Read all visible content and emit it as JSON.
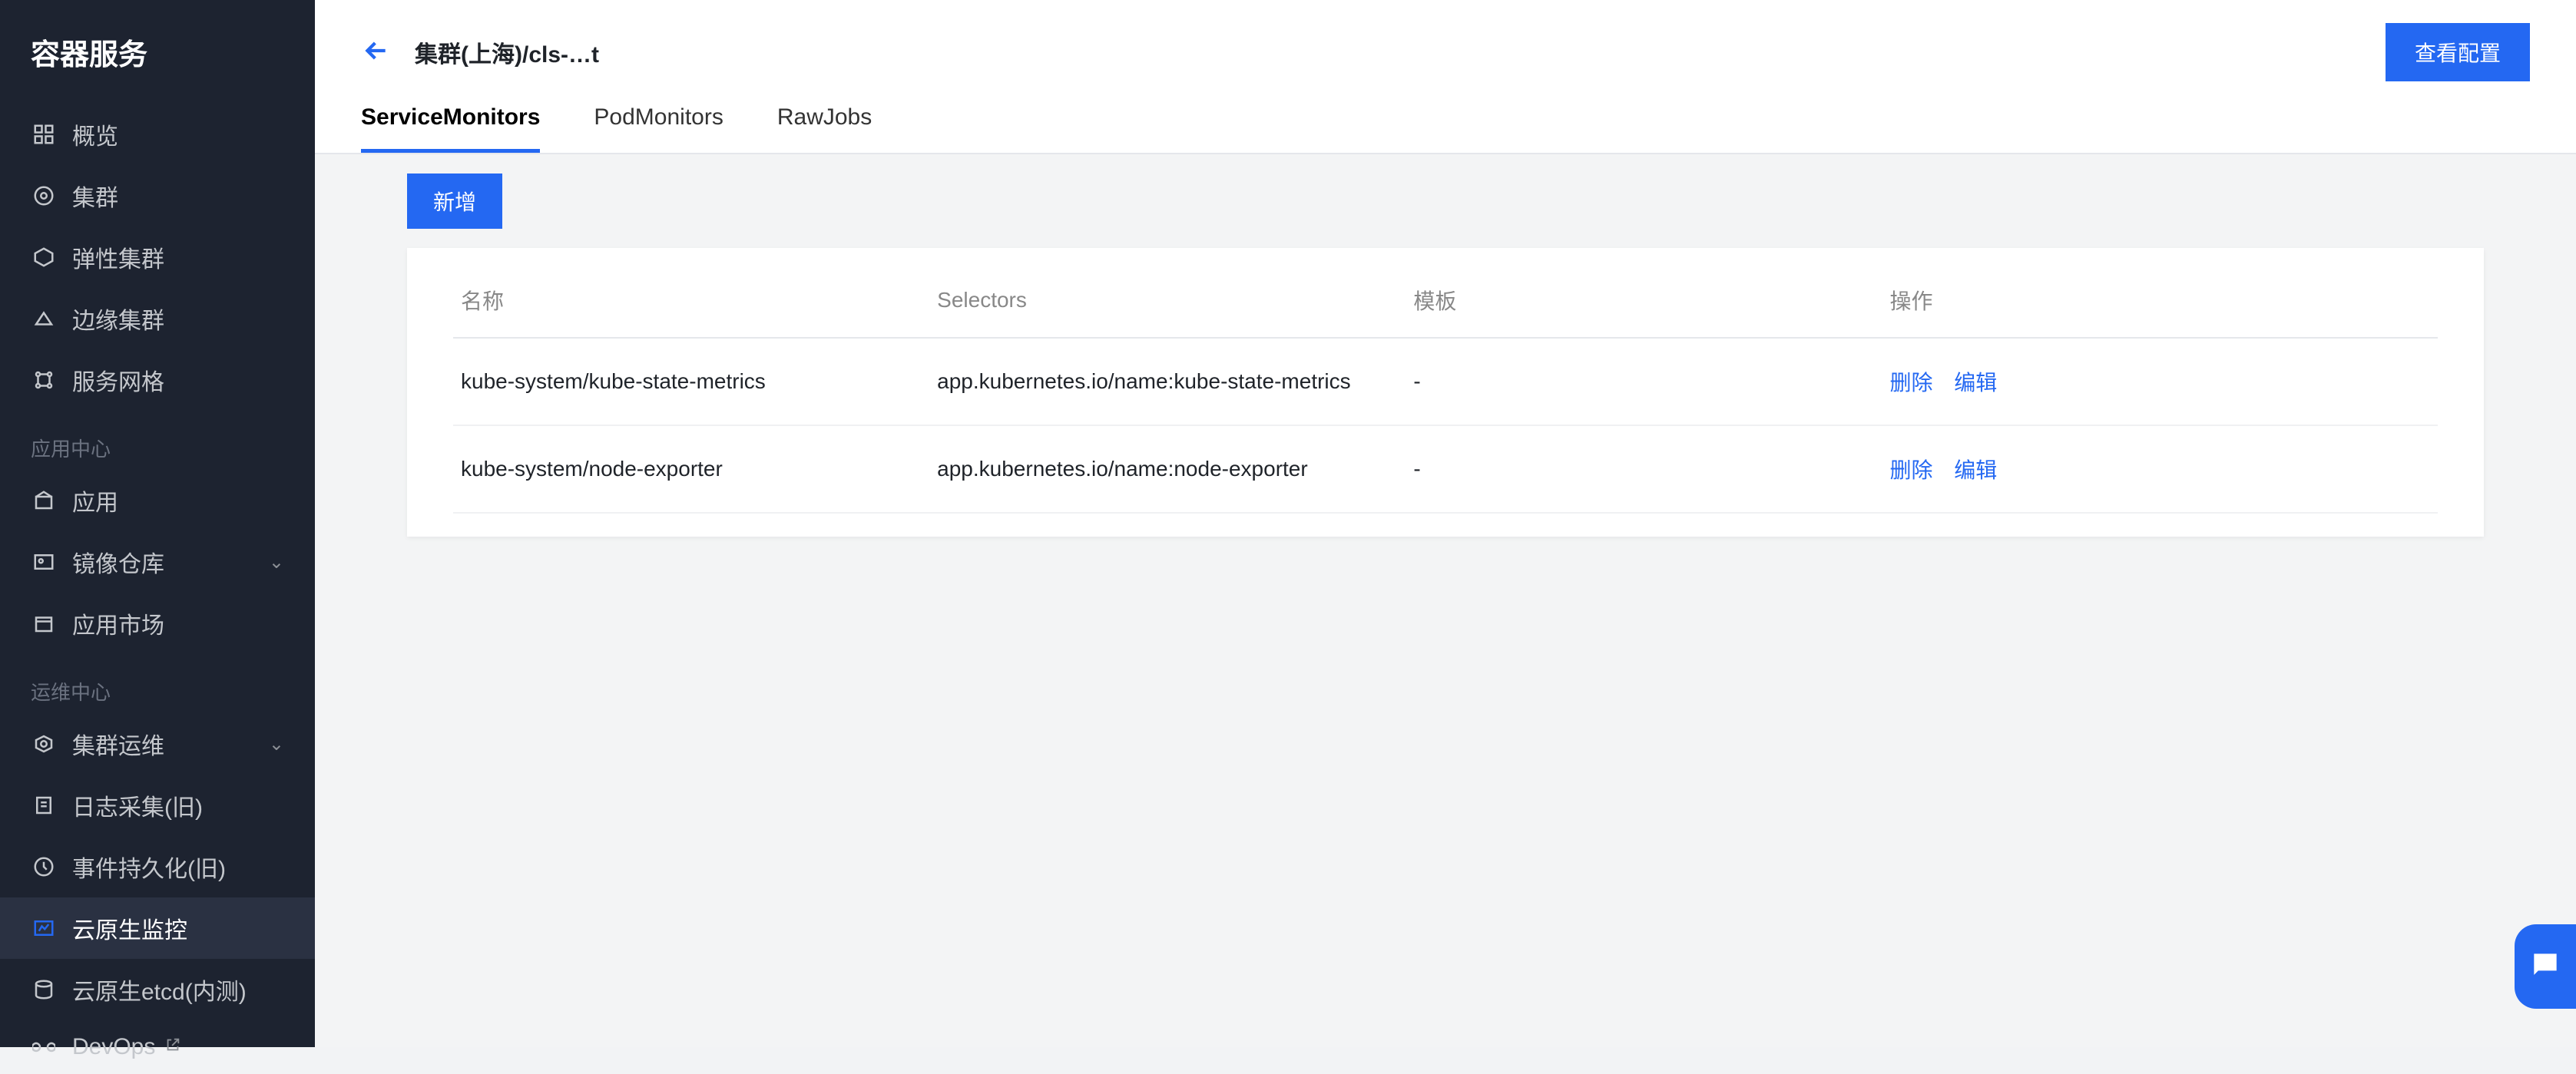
{
  "sidebar": {
    "title": "容器服务",
    "sections": [
      {
        "items": [
          {
            "label": "概览",
            "icon": "grid-icon"
          },
          {
            "label": "集群",
            "icon": "target-icon"
          },
          {
            "label": "弹性集群",
            "icon": "cluster-icon"
          },
          {
            "label": "边缘集群",
            "icon": "edge-icon"
          },
          {
            "label": "服务网格",
            "icon": "mesh-icon"
          }
        ]
      },
      {
        "label": "应用中心",
        "items": [
          {
            "label": "应用",
            "icon": "app-icon"
          },
          {
            "label": "镜像仓库",
            "icon": "image-repo-icon",
            "chevron": true
          },
          {
            "label": "应用市场",
            "icon": "market-icon"
          }
        ]
      },
      {
        "label": "运维中心",
        "items": [
          {
            "label": "集群运维",
            "icon": "ops-icon",
            "chevron": true
          },
          {
            "label": "日志采集(旧)",
            "icon": "log-icon"
          },
          {
            "label": "事件持久化(旧)",
            "icon": "event-icon"
          },
          {
            "label": "云原生监控",
            "icon": "monitor-icon",
            "active": true
          },
          {
            "label": "云原生etcd(内测)",
            "icon": "etcd-icon"
          },
          {
            "label": "DevOps",
            "icon": "devops-icon",
            "external": true
          }
        ]
      }
    ]
  },
  "header": {
    "breadcrumb": "集群(上海)/cls-…t",
    "view_config_label": "查看配置"
  },
  "tabs": [
    {
      "id": "service-monitors",
      "label": "ServiceMonitors",
      "active": true
    },
    {
      "id": "pod-monitors",
      "label": "PodMonitors"
    },
    {
      "id": "raw-jobs",
      "label": "RawJobs"
    }
  ],
  "buttons": {
    "add_label": "新增"
  },
  "table": {
    "columns": {
      "name": "名称",
      "selectors": "Selectors",
      "template": "模板",
      "actions": "操作"
    },
    "action_labels": {
      "delete": "删除",
      "edit": "编辑"
    },
    "rows": [
      {
        "name": "kube-system/kube-state-metrics",
        "selectors": "app.kubernetes.io/name:kube-state-metrics",
        "template": "-"
      },
      {
        "name": "kube-system/node-exporter",
        "selectors": "app.kubernetes.io/name:node-exporter",
        "template": "-"
      }
    ]
  }
}
